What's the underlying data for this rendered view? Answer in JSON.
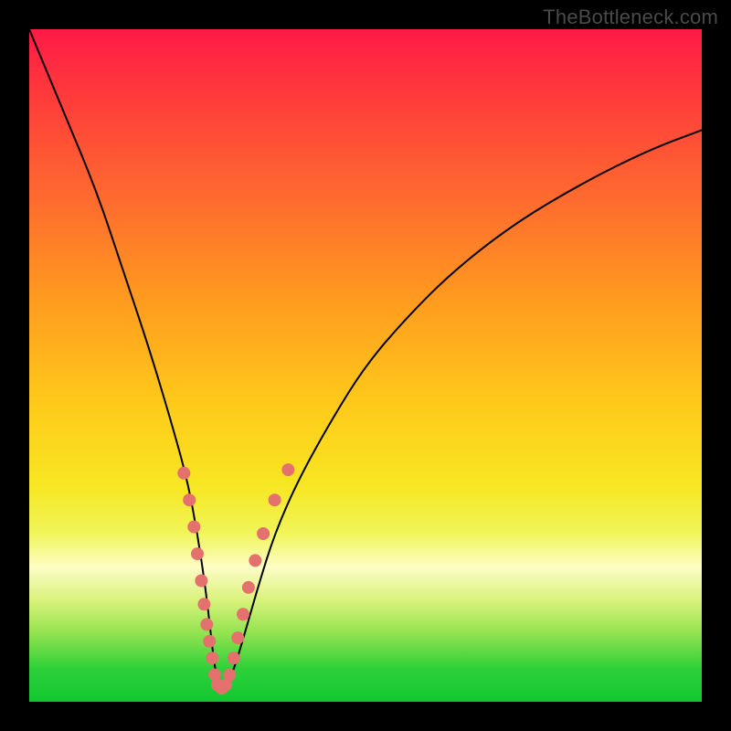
{
  "watermark": "TheBottleneck.com",
  "colors": {
    "background": "#000000",
    "gradient_top": "#ff1a46",
    "gradient_bottom": "#11c730",
    "curve": "#000000",
    "dots": "#e4716e"
  },
  "chart_data": {
    "type": "line",
    "title": "",
    "xlabel": "",
    "ylabel": "",
    "xlim": [
      0,
      100
    ],
    "ylim": [
      0,
      100
    ],
    "x": [
      0,
      5,
      10,
      14,
      18,
      21,
      23.5,
      25,
      26.2,
      27,
      27.6,
      28.3,
      29.2,
      30.5,
      32,
      34,
      36.5,
      40,
      45,
      50,
      56,
      63,
      72,
      82,
      92,
      100
    ],
    "values": [
      100,
      88,
      76,
      64,
      52,
      42,
      33,
      25,
      17,
      10,
      5,
      2,
      2,
      5,
      10,
      17,
      25,
      33,
      42,
      50,
      57,
      64,
      71,
      77,
      82,
      85
    ],
    "dots": [
      {
        "x": 23.0,
        "y": 34.0
      },
      {
        "x": 23.8,
        "y": 30.0
      },
      {
        "x": 24.5,
        "y": 26.0
      },
      {
        "x": 25.0,
        "y": 22.0
      },
      {
        "x": 25.6,
        "y": 18.0
      },
      {
        "x": 26.0,
        "y": 14.5
      },
      {
        "x": 26.4,
        "y": 11.5
      },
      {
        "x": 26.8,
        "y": 9.0
      },
      {
        "x": 27.2,
        "y": 6.5
      },
      {
        "x": 27.6,
        "y": 4.0
      },
      {
        "x": 28.0,
        "y": 2.5
      },
      {
        "x": 28.6,
        "y": 2.0
      },
      {
        "x": 29.2,
        "y": 2.5
      },
      {
        "x": 29.8,
        "y": 4.0
      },
      {
        "x": 30.4,
        "y": 6.5
      },
      {
        "x": 31.0,
        "y": 9.5
      },
      {
        "x": 31.8,
        "y": 13.0
      },
      {
        "x": 32.6,
        "y": 17.0
      },
      {
        "x": 33.6,
        "y": 21.0
      },
      {
        "x": 34.8,
        "y": 25.0
      },
      {
        "x": 36.5,
        "y": 30.0
      },
      {
        "x": 38.5,
        "y": 34.5
      }
    ],
    "dot_radius": 7
  }
}
